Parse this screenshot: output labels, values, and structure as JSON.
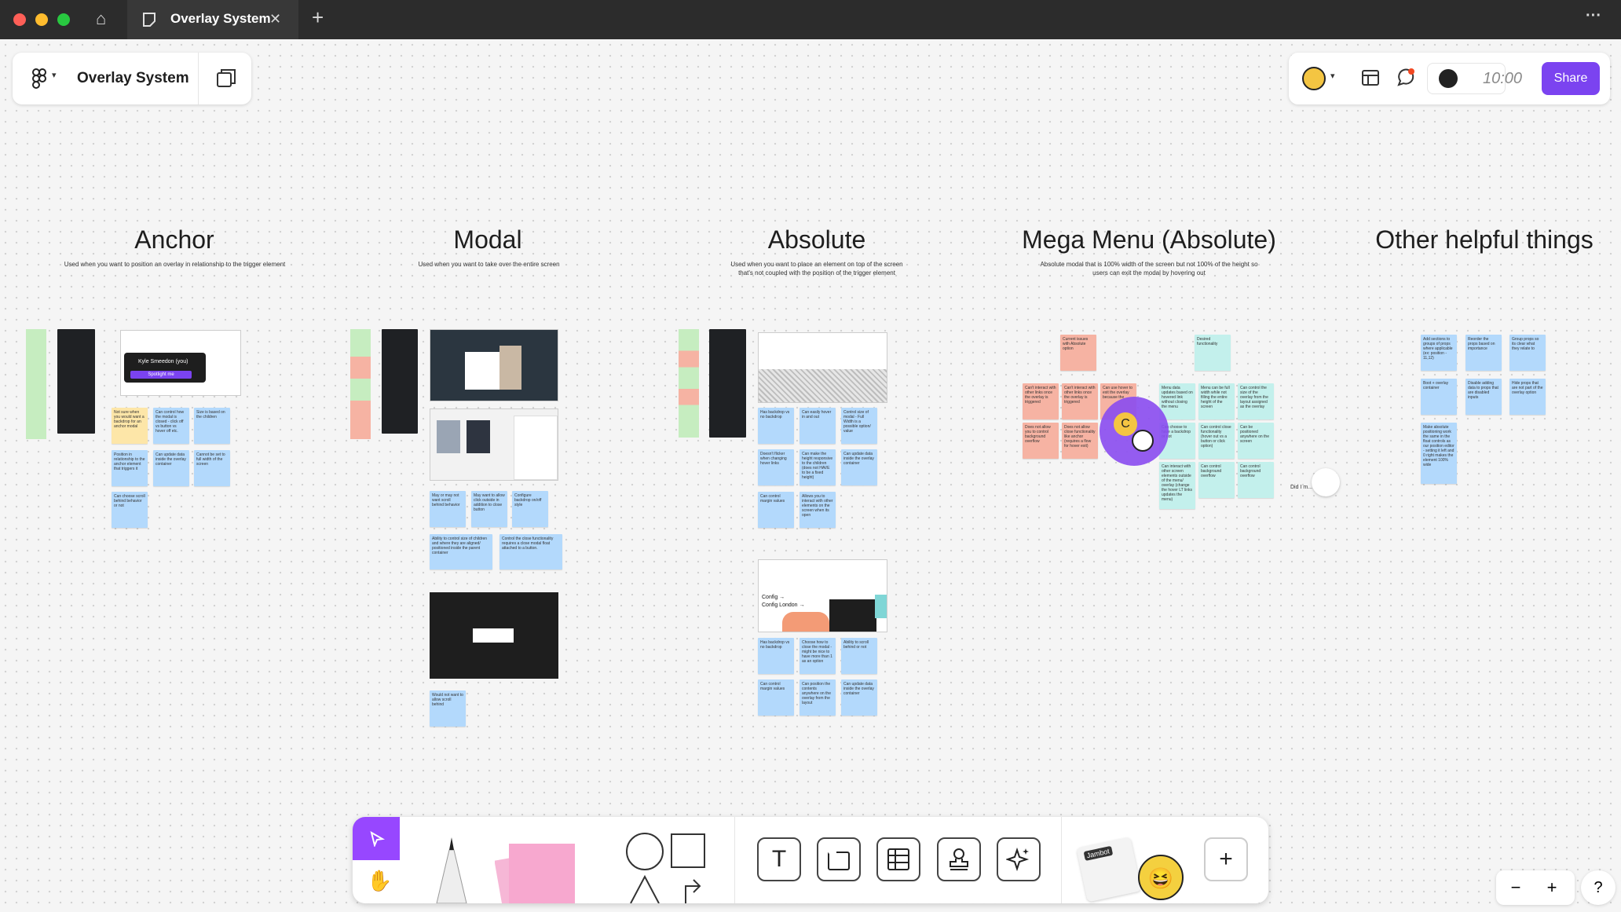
{
  "window": {
    "tab_title": "Overlay System",
    "new_tab_symbol": "+",
    "close_symbol": "✕",
    "more_symbol": "···",
    "home_symbol": "⌂"
  },
  "header": {
    "file_name": "Overlay System",
    "timer": "10:00",
    "share_label": "Share"
  },
  "sections": [
    {
      "title": "Anchor",
      "subtitle": "Used when you want to position an overlay in relationship to the trigger element"
    },
    {
      "title": "Modal",
      "subtitle": "Used when you want to take over the entire screen"
    },
    {
      "title": "Absolute",
      "subtitle": "Used when you want to place an element on top of the screen that's not coupled with the position of the trigger element"
    },
    {
      "title": "Mega Menu (Absolute)",
      "subtitle": "Absolute modal that is 100% width of the screen but not 100% of the height so users can exit the modal by hovering out"
    },
    {
      "title": "Other helpful things",
      "subtitle": ""
    }
  ],
  "anchor": {
    "tooltip_user": "Kyle Smeedon (you)",
    "tooltip_button": "Spotlight me",
    "stickies": [
      "Not sure when you would want a backdrop for an anchor modal",
      "Can control how the modal is closed - click off vs button vs hover off etc.",
      "Size is based on the children",
      "Cannot be set to full width of the screen",
      "Position in relationship to the anchor element that triggers it",
      "Can update data inside the overlay container",
      "Can control margin values",
      "Can choose scroll behind behavior or not"
    ]
  },
  "modal": {
    "stickies": [
      "May or may not want scroll behind behavior",
      "May want to allow click outside in addition to close button",
      "Configure backdrop on/off style",
      "Ability to control size of children and where they are aligned/ positioned inside the parent container",
      "Control the close functionality requires a close modal float attached to a button.",
      "Would not want to allow scroll behind"
    ]
  },
  "absolute": {
    "stickies": [
      "Has backdrop vs no backdrop",
      "Can easily hover in and out",
      "Control size of modal - Full Width is a possible option/ value",
      "Doesn't flicker when changing hover links",
      "Can make the height responsive to the children (does not HAVE to be a fixed height)",
      "Can update data inside the overlay container",
      "Can control margin values",
      "Allows you to interact with other elements on the screen when its open",
      "Has backdrop vs no backdrop",
      "Choose how to close the modal - might be nice to have more than 1 as an option",
      "Ability to scroll behind or not",
      "Ex: user can click",
      "Can control margin values",
      "Can position the contents anywhere on the overlay from the layout",
      "Can update data inside the overlay container"
    ],
    "promo_heading": "Config →",
    "promo_sub": "Config London →"
  },
  "mega": {
    "stickies_red": [
      "Current issues with Absolute option",
      "Can't interact with other links once the overlay is triggered",
      "Can't interact with other links once the overlay is triggered",
      "Can use hover to exit the overlay because the",
      "Z index issue?",
      "Does not allow you to control background overflow",
      "Does not allow close functionality like anchor (requires a flow for hover exit)"
    ],
    "stickies_teal": [
      "Desired functionality",
      "Menu data updates based on hovered link without closing the menu",
      "Menu can be full width while not filling the entire height of the screen",
      "Can control the size of the overlay from the layout assigned as the overlay",
      "Can choose to have a backdrop or not",
      "Can control close functionality (hover out vs a button or click option)",
      "Can be positioned anywhere on the screen",
      "Can interact with other screen elements outside of the menu/ overlay (change the hover LT links updates the menu)",
      "Can control background overflow",
      "Can control background overflow"
    ],
    "cursor_letter": "C",
    "comment_text": "Did I m... g?"
  },
  "other": {
    "stickies": [
      "Add sections to groups of props where applicable (ex: position - 11,12)",
      "Reorder the props based on importance",
      "Group props so its clear what they relate to",
      "Boot + overlay container",
      "Disable adding data to props that are disabled inputs",
      "Hide props that are not part of the overlay option",
      "Instead of the extra div we can't control today",
      "Make absolute positioning work the same in the float controls as our position editor - setting it left and 0 right makes the element 100% wide"
    ]
  },
  "toolbar": {
    "text_tool": "T",
    "add_symbol": "+",
    "jambot_label": "Jambot"
  },
  "zoom": {
    "minus": "−",
    "plus": "+",
    "help": "?"
  },
  "colors": {
    "accent": "#7b43f0",
    "titlebar": "#2c2c2c",
    "sticky_blue": "#b3d9fc",
    "sticky_yellow": "#fde6a8",
    "sticky_red": "#f6b3a3",
    "sticky_teal": "#c3f0ec",
    "sticky_green": "#c6edc0"
  }
}
